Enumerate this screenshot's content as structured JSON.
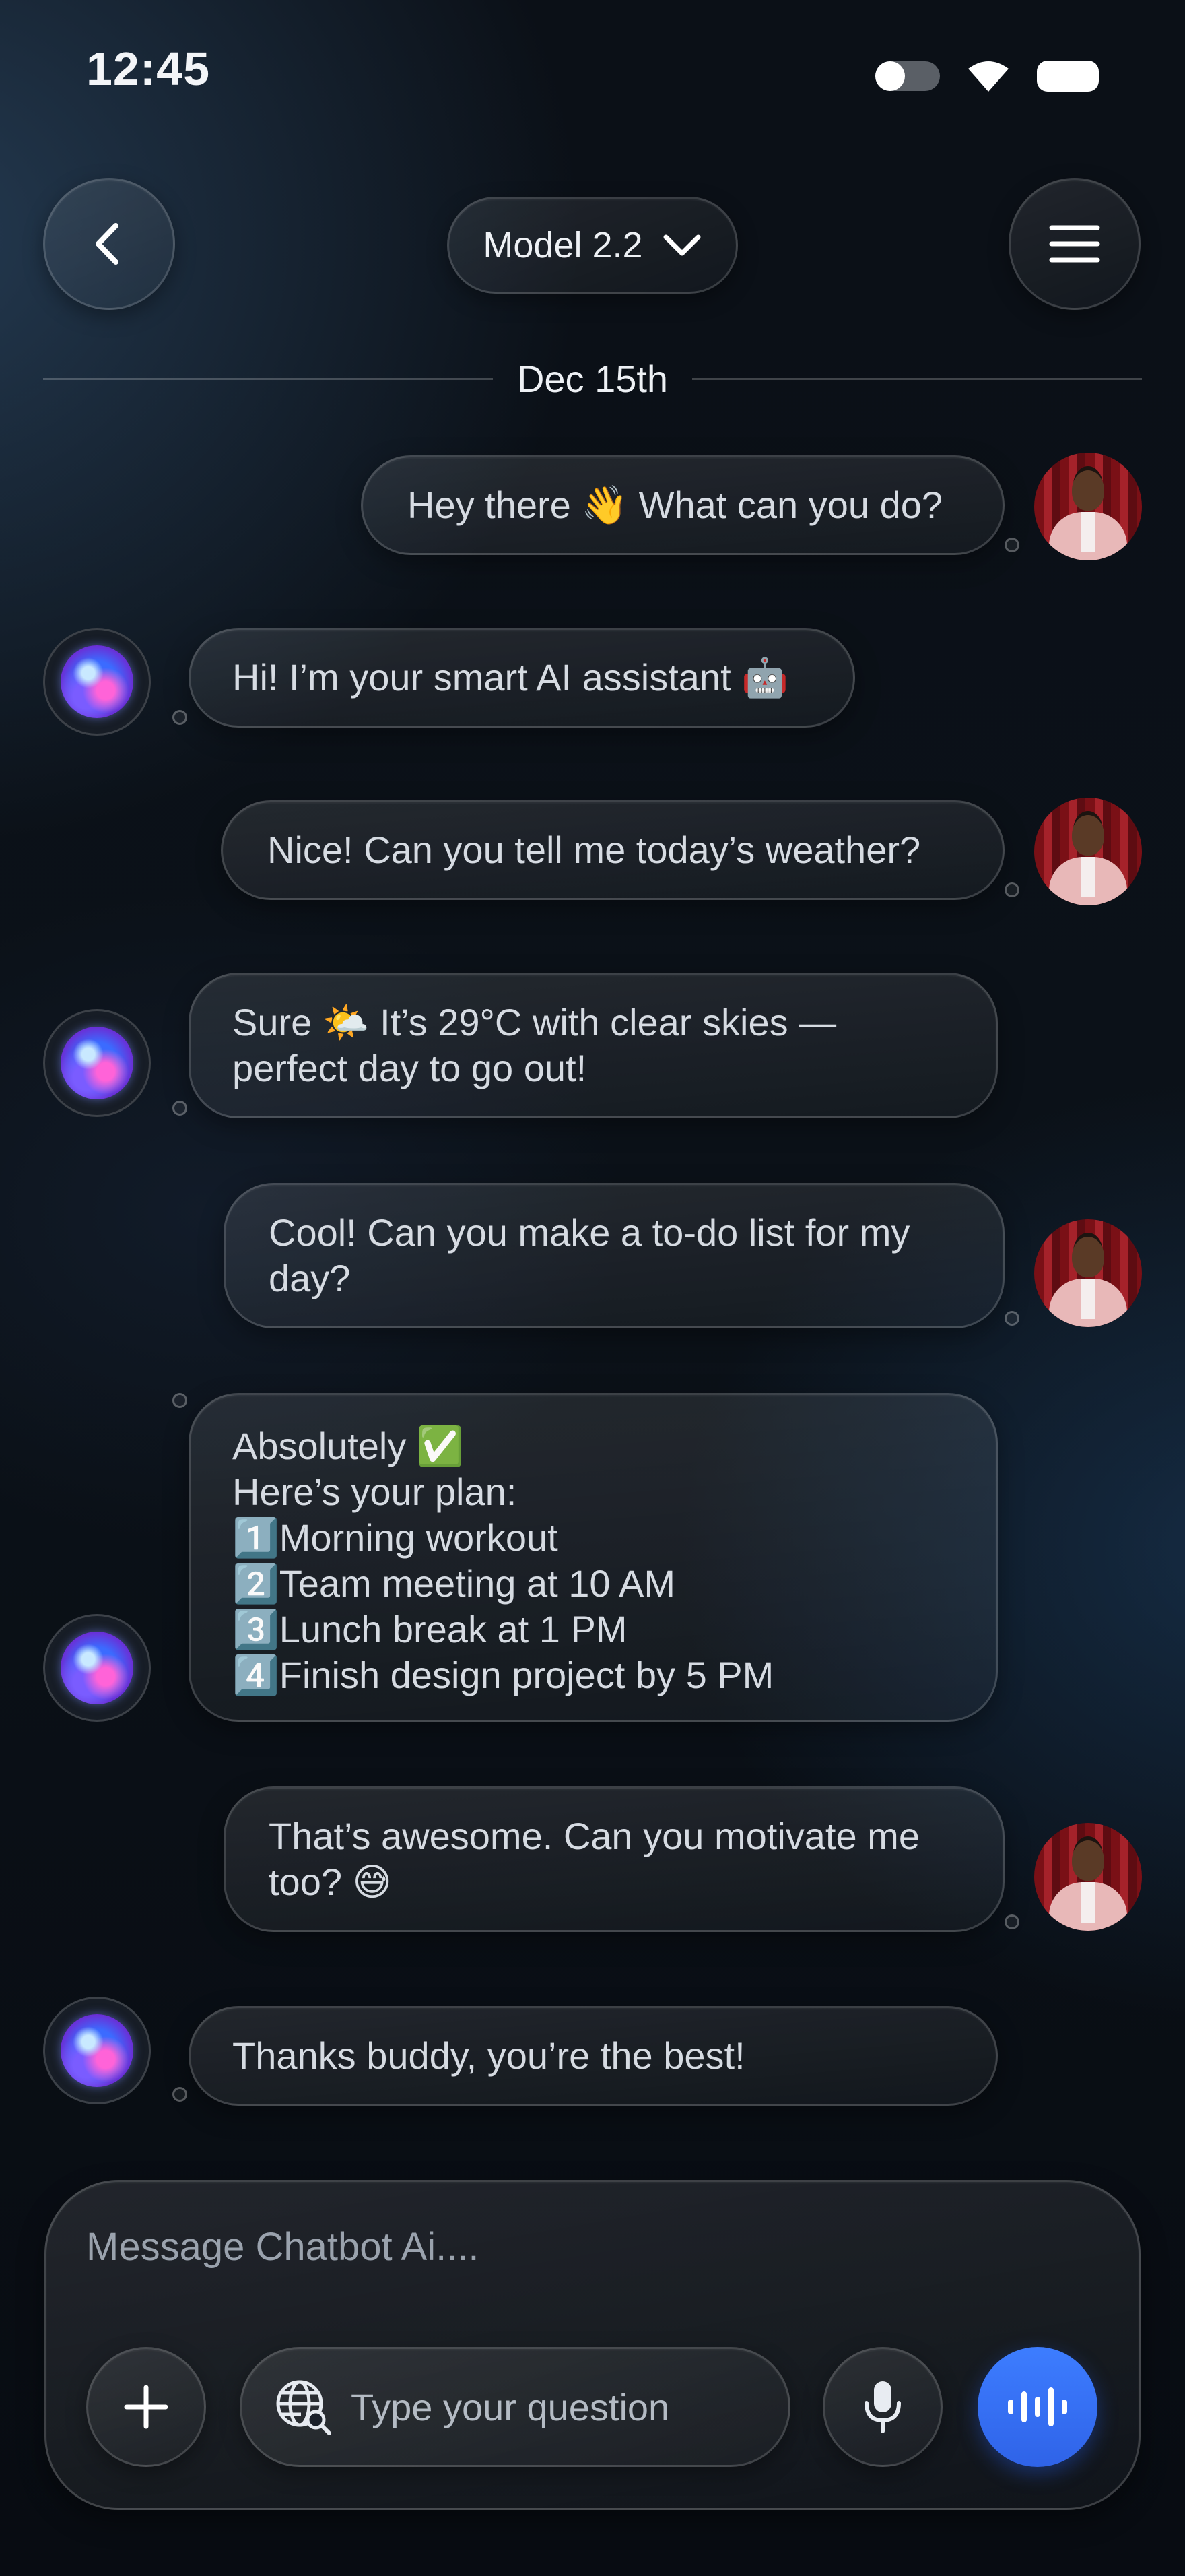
{
  "status_bar": {
    "time": "12:45"
  },
  "header": {
    "model_label": "Model 2.2"
  },
  "date_divider": "Dec 15th",
  "messages": [
    {
      "sender": "user",
      "lines": [
        "Hey there 👋 What can you do?"
      ]
    },
    {
      "sender": "bot",
      "lines": [
        "Hi! I’m your smart AI assistant 🤖"
      ]
    },
    {
      "sender": "user",
      "lines": [
        "Nice! Can you tell me today’s weather?"
      ]
    },
    {
      "sender": "bot",
      "lines": [
        "Sure 🌤️ It’s 29°C with clear skies —",
        "perfect day to go out!"
      ]
    },
    {
      "sender": "user",
      "lines": [
        "Cool! Can you make a to-do list for my",
        "day?"
      ]
    },
    {
      "sender": "bot",
      "lines": [
        "Absolutely ✅",
        "Here’s your plan:",
        "1️⃣Morning workout",
        "2️⃣Team meeting at 10 AM",
        "3️⃣Lunch break at 1 PM",
        "4️⃣Finish design project by 5 PM"
      ]
    },
    {
      "sender": "user",
      "lines": [
        "That’s awesome. Can you motivate me",
        "too? 😅"
      ]
    },
    {
      "sender": "bot",
      "lines": [
        "Thanks buddy, you’re the best!"
      ]
    }
  ],
  "composer": {
    "placeholder": "Message Chatbot Ai....",
    "question_placeholder": "Type your question"
  },
  "icons": {
    "back": "chevron-left-icon",
    "model_dropdown": "chevron-down-icon",
    "menu": "hamburger-menu-icon",
    "add": "plus-icon",
    "web_search": "globe-search-icon",
    "microphone": "microphone-icon",
    "voice": "sound-wave-icon"
  },
  "colors": {
    "accent_blue": "#3d7dff",
    "background": "#0b1017"
  }
}
